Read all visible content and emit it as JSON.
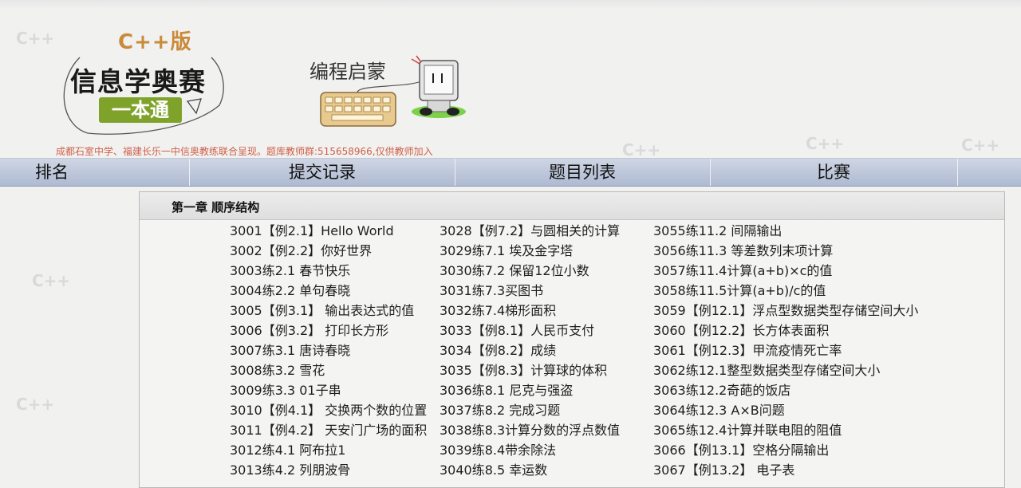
{
  "announcement": "成都石室中学、福建长乐一中信奥教练联合呈现。题库教师群:515658966,仅供教师加入",
  "logo": {
    "edition": "C++版",
    "title": "信息学奥赛",
    "subtitle": "一本通"
  },
  "slogan": "编程启蒙",
  "nav": [
    {
      "label": "排名"
    },
    {
      "label": "提交记录"
    },
    {
      "label": "题目列表"
    },
    {
      "label": "比赛"
    }
  ],
  "chapter": {
    "title": "第一章 顺序结构",
    "columns": [
      [
        {
          "label": "3001【例2.1】Hello World"
        },
        {
          "label": "3002【例2.2】你好世界"
        },
        {
          "label": "3003练2.1 春节快乐"
        },
        {
          "label": "3004练2.2 单句春晓"
        },
        {
          "label": "3005【例3.1】 输出表达式的值"
        },
        {
          "label": "3006【例3.2】 打印长方形"
        },
        {
          "label": "3007练3.1 唐诗春晓"
        },
        {
          "label": "3008练3.2 雪花"
        },
        {
          "label": "3009练3.3 01子串"
        },
        {
          "label": "3010【例4.1】 交换两个数的位置"
        },
        {
          "label": "3011【例4.2】 天安门广场的面积"
        },
        {
          "label": "3012练4.1 阿布拉1"
        },
        {
          "label": "3013练4.2 列朋波骨"
        }
      ],
      [
        {
          "label": "3028【例7.2】与圆相关的计算"
        },
        {
          "label": "3029练7.1 埃及金字塔"
        },
        {
          "label": "3030练7.2 保留12位小数"
        },
        {
          "label": "3031练7.3买图书"
        },
        {
          "label": "3032练7.4梯形面积"
        },
        {
          "label": "3033【例8.1】人民币支付"
        },
        {
          "label": "3034【例8.2】成绩"
        },
        {
          "label": "3035【例8.3】计算球的体积"
        },
        {
          "label": "3036练8.1 尼克与强盗"
        },
        {
          "label": "3037练8.2 完成习题"
        },
        {
          "label": "3038练8.3计算分数的浮点数值"
        },
        {
          "label": "3039练8.4带余除法"
        },
        {
          "label": "3040练8.5 幸运数"
        }
      ],
      [
        {
          "label": "3055练11.2 间隔输出"
        },
        {
          "label": "3056练11.3 等差数列末项计算"
        },
        {
          "label": "3057练11.4计算(a+b)×c的值"
        },
        {
          "label": "3058练11.5计算(a+b)/c的值"
        },
        {
          "label": "3059【例12.1】浮点型数据类型存储空间大小"
        },
        {
          "label": "3060【例12.2】长方体表面积"
        },
        {
          "label": "3061【例12.3】甲流疫情死亡率"
        },
        {
          "label": "3062练12.1整型数据类型存储空间大小"
        },
        {
          "label": "3063练12.2奇葩的饭店"
        },
        {
          "label": "3064练12.3 A×B问题"
        },
        {
          "label": "3065练12.4计算并联电阻的阻值"
        },
        {
          "label": "3066【例13.1】空格分隔输出"
        },
        {
          "label": "3067【例13.2】 电子表"
        }
      ]
    ]
  },
  "colors": {
    "nav_bg": "#b8c3d9",
    "announcement": "#d0604a",
    "logo_badge": "#7fa32a",
    "logo_edition": "#c98a3a"
  }
}
